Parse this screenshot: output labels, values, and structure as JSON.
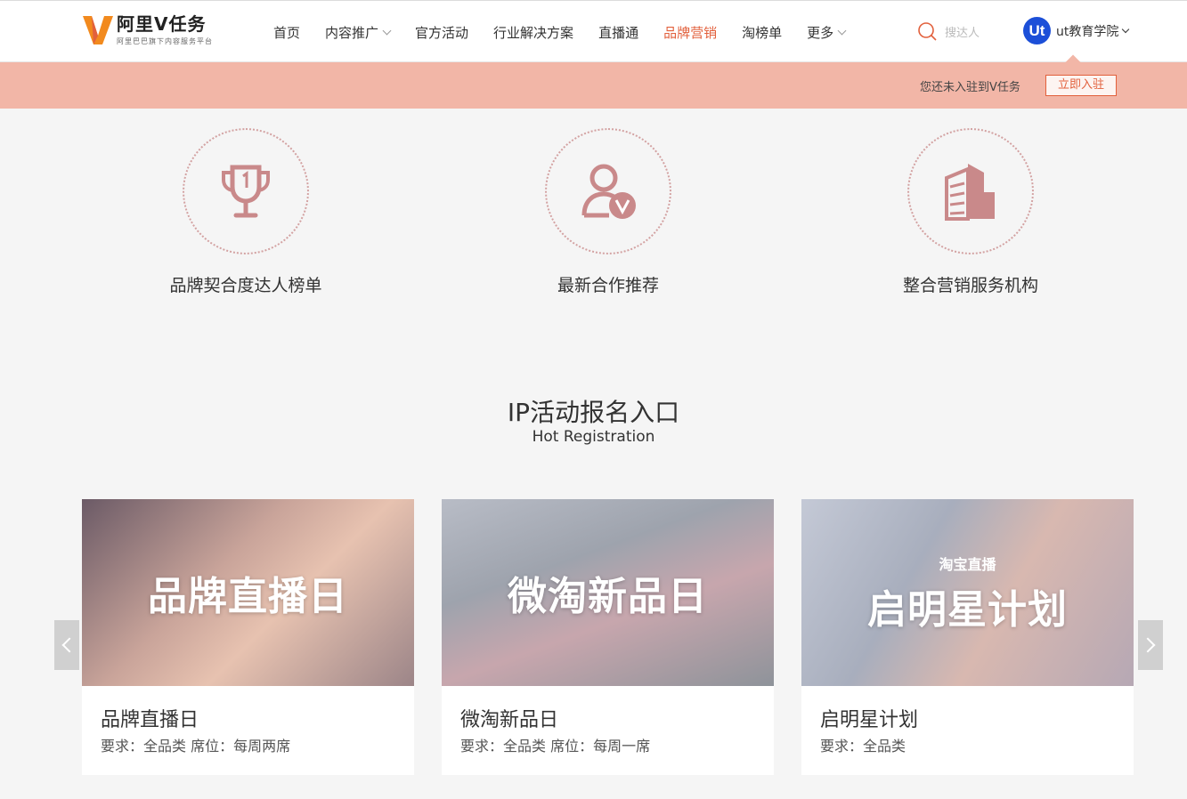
{
  "logo": {
    "title": "阿里V任务",
    "subtitle": "阿里巴巴旗下内容服务平台"
  },
  "nav": [
    {
      "label": "首页",
      "dropdown": false,
      "active": false
    },
    {
      "label": "内容推广",
      "dropdown": true,
      "active": false
    },
    {
      "label": "官方活动",
      "dropdown": false,
      "active": false
    },
    {
      "label": "行业解决方案",
      "dropdown": false,
      "active": false
    },
    {
      "label": "直播通",
      "dropdown": false,
      "active": false
    },
    {
      "label": "品牌营销",
      "dropdown": false,
      "active": true
    },
    {
      "label": "淘榜单",
      "dropdown": false,
      "active": false
    },
    {
      "label": "更多",
      "dropdown": true,
      "active": false
    }
  ],
  "search": {
    "placeholder": "搜达人"
  },
  "user": {
    "avatar_text": "Ut",
    "name": "ut教育学院"
  },
  "notice": {
    "text": "您还未入驻到V任务",
    "button": "立即入驻"
  },
  "features": [
    {
      "icon": "trophy-icon",
      "label": "品牌契合度达人榜单"
    },
    {
      "icon": "user-v-icon",
      "label": "最新合作推荐"
    },
    {
      "icon": "building-icon",
      "label": "整合营销服务机构"
    }
  ],
  "section": {
    "title": "IP活动报名入口",
    "subtitle": "Hot Registration"
  },
  "cards": [
    {
      "image_text": "品牌直播日",
      "title": "品牌直播日",
      "requirement": "要求：全品类 席位：每周两席"
    },
    {
      "image_text": "微淘新品日",
      "title": "微淘新品日",
      "requirement": "要求：全品类 席位：每周一席"
    },
    {
      "image_badge": "淘宝直播",
      "image_text": "启明星计划",
      "title": "启明星计划",
      "requirement": "要求：全品类"
    }
  ],
  "colors": {
    "accent": "#e2603c",
    "notice_bg": "#f2b6a7",
    "icon": "#c9898a",
    "avatar": "#1c4fd8"
  }
}
